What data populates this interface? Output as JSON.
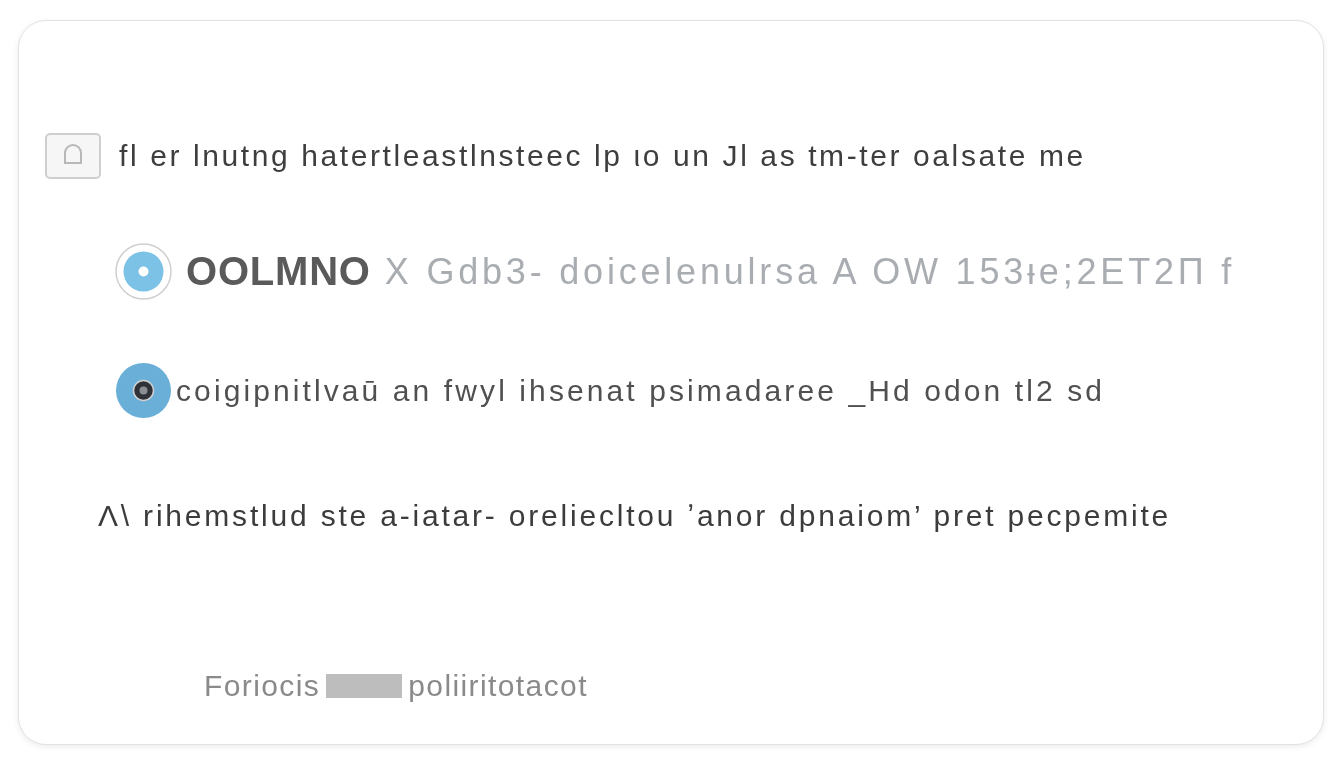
{
  "options": [
    {
      "kind": "checkbox",
      "checked": false,
      "text": "fl er lnutng hatertleastlnsteec lp ιo un Jl as tm-ter oalsate me"
    },
    {
      "kind": "radio",
      "selected": false,
      "label": "OOLMNO",
      "text": "X Gdb3- doicelenulrsa A OW 153ᵻe;2ET2Π f"
    },
    {
      "kind": "radio",
      "selected": true,
      "text": "coigipnitlvaū an fwyl ihsenat psimadaree _Hd odon tl2 sd"
    }
  ],
  "note": "Λ\\ rihemstlud ste a-iatar- oreliecltou ʼanor dpnaiom’ pret pecpemite",
  "footer": {
    "before": "Foriocis",
    "after": "poliiritotacot"
  }
}
